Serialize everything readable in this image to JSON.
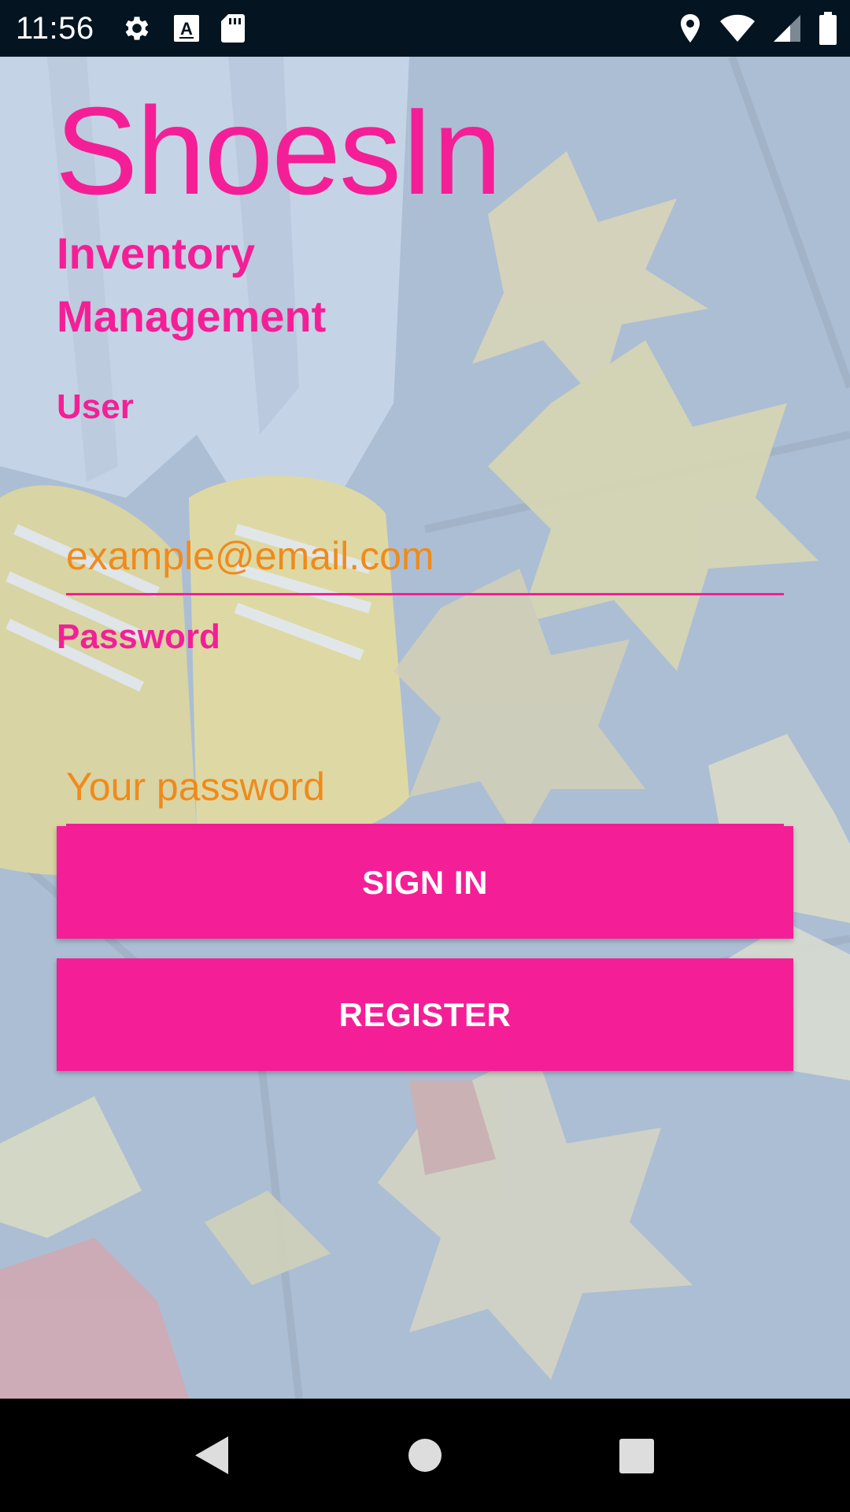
{
  "status_bar": {
    "time": "11:56",
    "left_icons": [
      "gear-icon",
      "text-a-icon",
      "sd-card-icon"
    ],
    "right_icons": [
      "location-icon",
      "wifi-icon",
      "signal-icon",
      "battery-icon"
    ]
  },
  "app": {
    "title": "ShoesIn",
    "subtitle": "Inventory Management"
  },
  "form": {
    "user_label": "User",
    "user_placeholder": "example@email.com",
    "password_label": "Password",
    "password_placeholder": "Your password",
    "sign_in_label": "SIGN IN",
    "register_label": "REGISTER"
  },
  "nav_bar": {
    "icons": [
      "back-icon",
      "home-icon",
      "recents-icon"
    ]
  },
  "colors": {
    "accent": "#f41f96",
    "placeholder": "#f08a1c",
    "status_bar": "#041420",
    "nav_bar": "#000000"
  }
}
